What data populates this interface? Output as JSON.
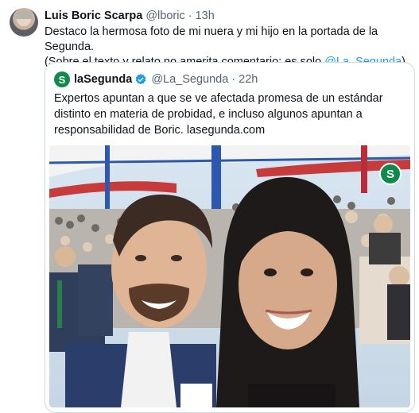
{
  "tweet": {
    "author_name": "Luis Boric Scarpa",
    "handle": "@lboric",
    "separator": "·",
    "time": "13h",
    "text_line1": "Destaco la hermosa foto de mi nuera y mi hijo en la portada de la Segunda.",
    "text_line2_prefix": "(Sobre el texto y relato no amerita comentario; es solo ",
    "mention": "@La_Segunda",
    "text_line2_suffix": ")."
  },
  "quote": {
    "logo_letter": "S",
    "name": "laSegunda",
    "handle": "@La_Segunda",
    "separator": "·",
    "time": "22h",
    "text": "Expertos apuntan a que se ve afectada promesa de un estándar distinto en materia de probidad, e incluso algunos apuntan a responsabilidad de Boric. lasegunda.com",
    "photo_badge_letter": "S"
  },
  "icons": {
    "verified": "verified-badge-icon",
    "brand_color": "#1d9bf0",
    "logo_color": "#0f8a4a"
  }
}
